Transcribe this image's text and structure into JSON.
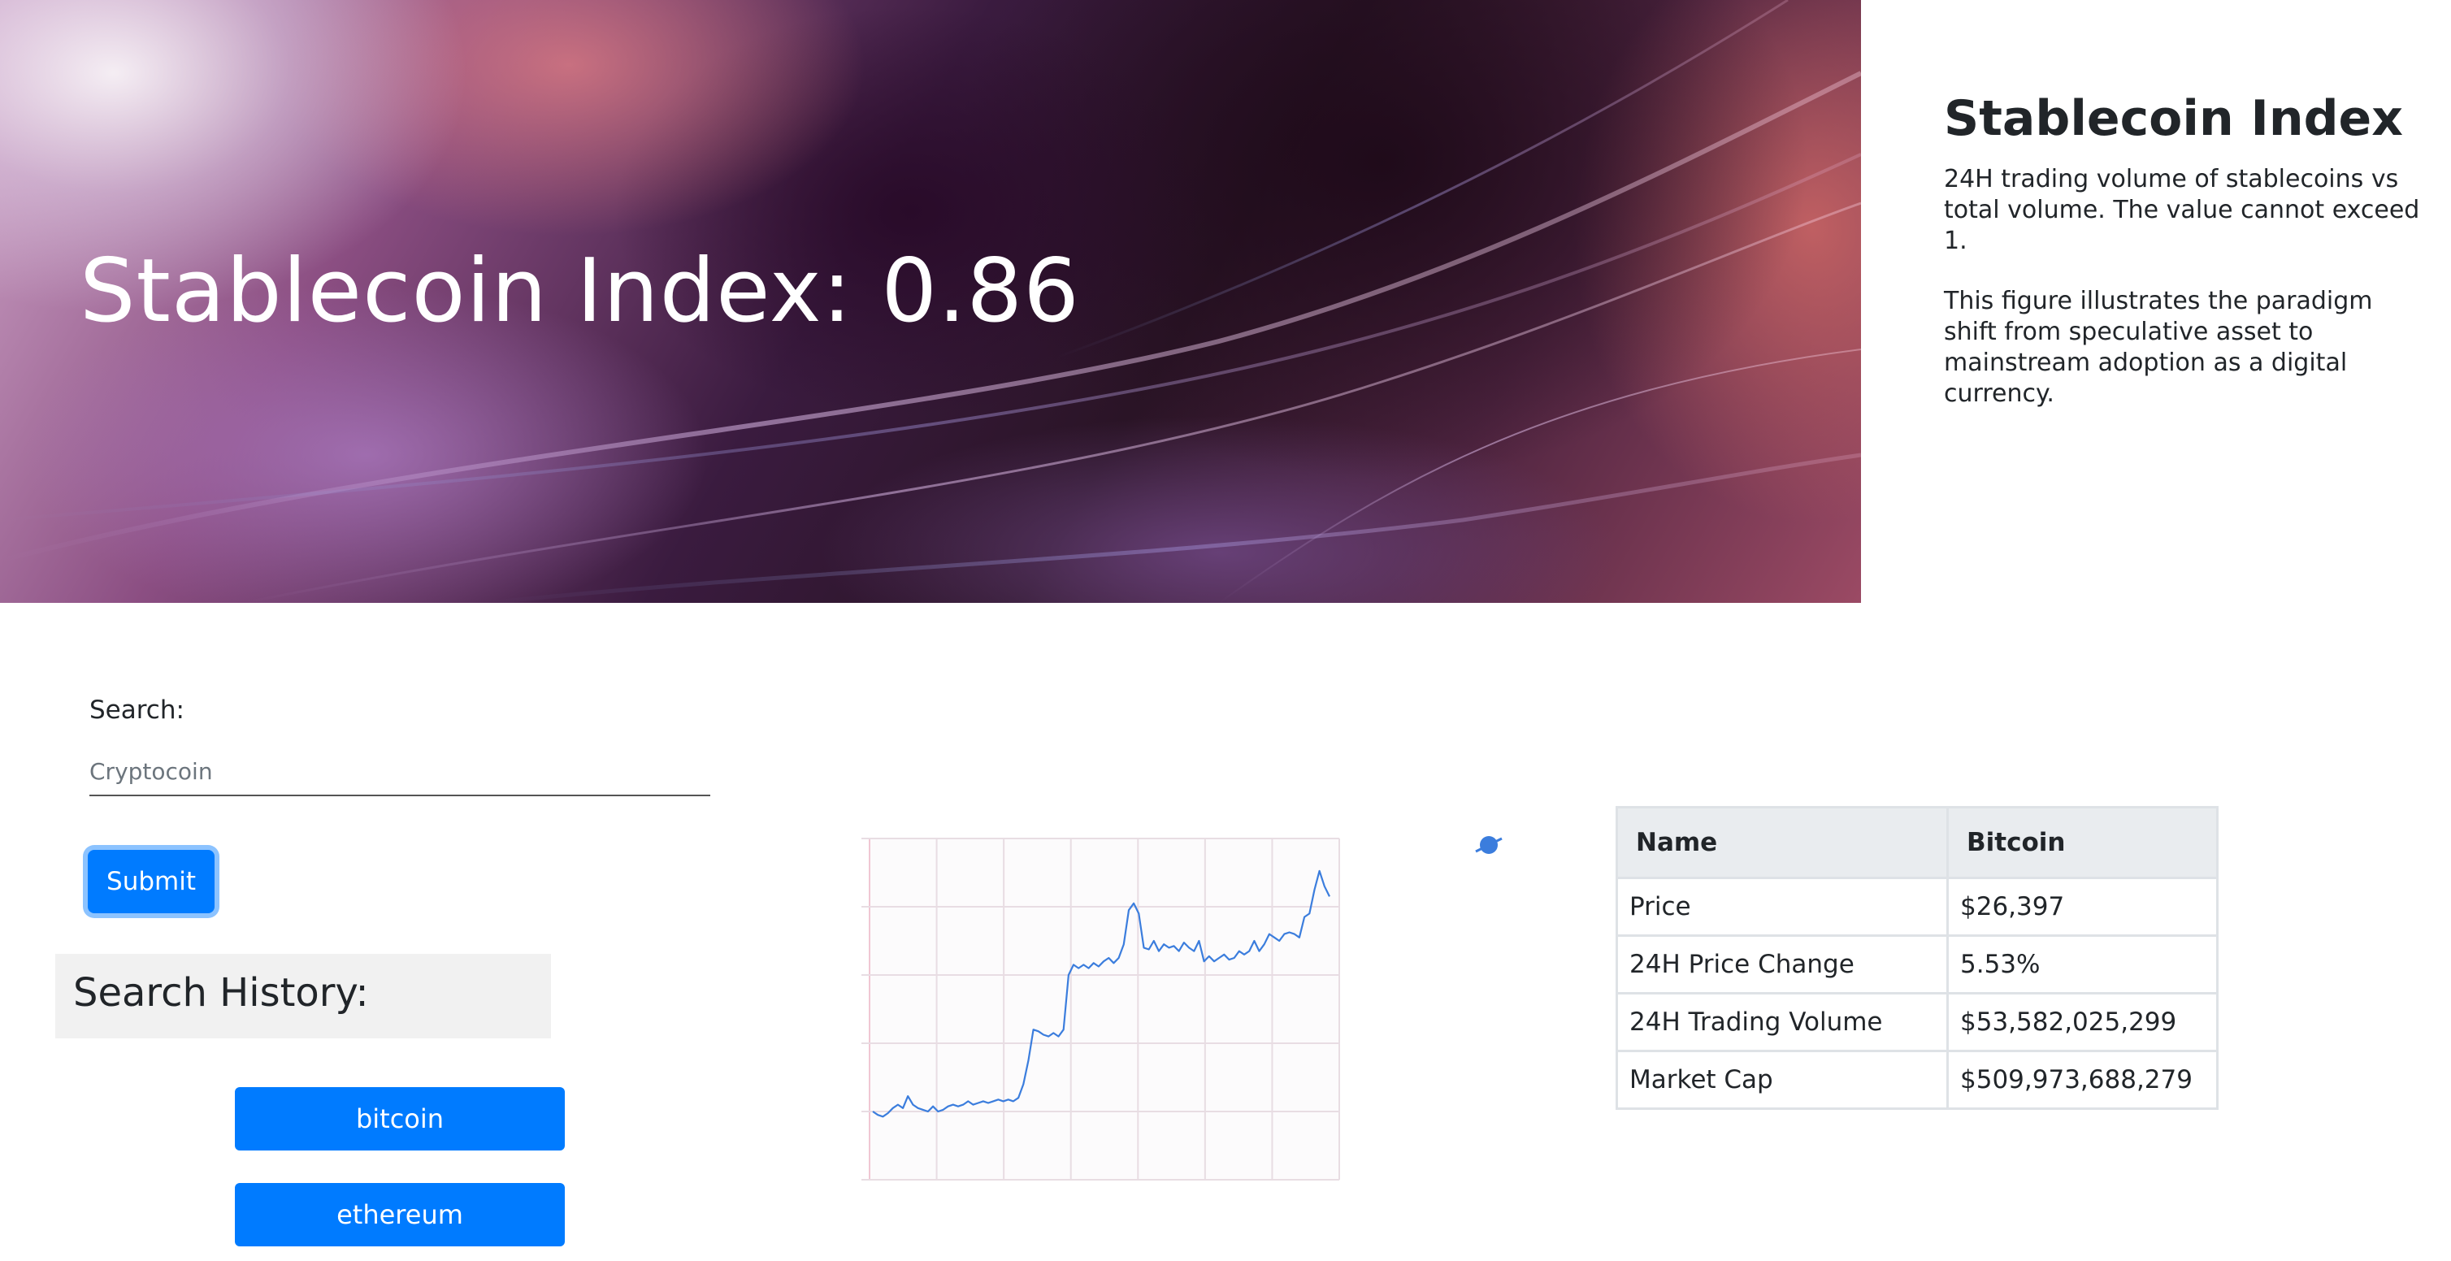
{
  "hero": {
    "title": "Stablecoin Index: 0.86"
  },
  "info": {
    "title": "Stablecoin Index",
    "paragraph1": "24H trading volume of stablecoins vs total volume. The value cannot exceed 1.",
    "paragraph2": "This figure illustrates the paradigm shift from speculative asset to mainstream adoption as a digital currency."
  },
  "search": {
    "label": "Search:",
    "placeholder": "Cryptocoin",
    "value": "",
    "submit_label": "Submit"
  },
  "history": {
    "title": "Search History:",
    "items": [
      {
        "label": "bitcoin"
      },
      {
        "label": "ethereum"
      }
    ]
  },
  "table": {
    "headers": [
      "Name",
      "Bitcoin"
    ],
    "rows": [
      {
        "label": "Price",
        "value": "$26,397"
      },
      {
        "label": "24H Price Change",
        "value": "5.53%"
      },
      {
        "label": "24H Trading Volume",
        "value": "$53,582,025,299"
      },
      {
        "label": "Market Cap",
        "value": "$509,973,688,279"
      }
    ]
  },
  "colors": {
    "primary": "#007bff",
    "line": "#3b7ddd",
    "grid": "#e8dde3",
    "table_header_bg": "#e9ecef"
  },
  "chart_data": {
    "type": "line",
    "title": "",
    "xlabel": "",
    "ylabel": "",
    "grid": true,
    "legend": "none",
    "ylim": [
      0,
      100
    ],
    "series": [
      {
        "values": [
          20,
          19,
          18.5,
          19.5,
          21,
          22,
          21,
          24.5,
          22,
          21,
          20.5,
          20,
          21.5,
          20,
          20.5,
          21.5,
          22,
          21.5,
          22,
          23,
          22,
          22.5,
          23,
          22.5,
          23,
          23.5,
          23,
          23.5,
          23,
          24,
          28,
          35,
          44,
          43.5,
          42.5,
          42,
          43,
          42,
          44,
          60,
          63,
          62,
          63,
          62,
          63.5,
          62.5,
          64,
          65,
          63.5,
          65,
          69,
          79,
          81,
          78,
          68,
          67.5,
          70,
          67,
          69,
          68,
          68.5,
          67,
          69.5,
          68,
          67,
          70,
          64,
          65.5,
          64,
          65,
          66,
          64.5,
          65,
          67,
          66,
          67,
          70,
          67,
          69,
          72,
          71,
          70,
          72,
          72.5,
          72,
          71,
          77,
          78,
          85,
          90.5,
          86,
          83
        ]
      }
    ]
  }
}
